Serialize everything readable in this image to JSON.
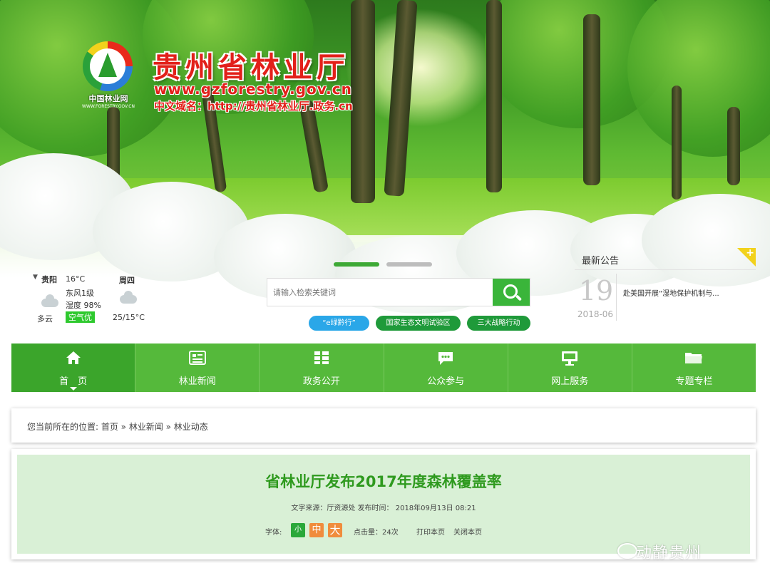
{
  "header": {
    "logo_name": "中国林业网",
    "logo_url": "WWW.FORESTRY.GOV.CN",
    "site_title": "贵州省林业厅",
    "site_url": "www.gzforestry.gov.cn",
    "site_domain": "中文域名：http://贵州省林业厅.政务.cn"
  },
  "weather": {
    "city": "贵阳",
    "temp": "16°C",
    "weekday": "周四",
    "wind": "东风1级",
    "humidity": "湿度 98%",
    "condition": "多云",
    "air_quality": "空气优",
    "range": "25/15°C"
  },
  "search": {
    "placeholder": "请输入检索关键词"
  },
  "quick_links": [
    "“e绿黔行”",
    "国家生态文明试验区",
    "三大战略行动"
  ],
  "notice": {
    "title": "最新公告",
    "day": "19",
    "month": "2018-06",
    "text": "赴美国开展“湿地保护机制与..."
  },
  "nav": [
    {
      "label": "首　页",
      "icon": "home-icon"
    },
    {
      "label": "林业新闻",
      "icon": "news-icon"
    },
    {
      "label": "政务公开",
      "icon": "grid-icon"
    },
    {
      "label": "公众参与",
      "icon": "chat-icon"
    },
    {
      "label": "网上服务",
      "icon": "monitor-icon"
    },
    {
      "label": "专题专栏",
      "icon": "folder-icon"
    }
  ],
  "breadcrumb": "您当前所在的位置: 首页 » 林业新闻 » 林业动态",
  "article": {
    "title": "省林业厅发布2017年度森林覆盖率",
    "meta": "文字来源：厅资源处  发布时间：  2018年09月13日 08:21",
    "font_label": "字体:",
    "font_small": "小",
    "font_medium": "中",
    "font_large": "大",
    "views": "点击量：24次",
    "print": "打印本页",
    "close": "关闭本页"
  },
  "watermark": "动静贵州",
  "colors": {
    "brand_green": "#55b93b",
    "active_green": "#3ba52b",
    "title_red": "#e2201a",
    "article_title": "#2f9a1f",
    "font_small_bg": "#2aa83a",
    "font_medium_bg": "#f08c3c",
    "font_large_bg": "#f08c3c",
    "link_blue": "#2aa7e8",
    "link_green": "#1f9a3a"
  }
}
